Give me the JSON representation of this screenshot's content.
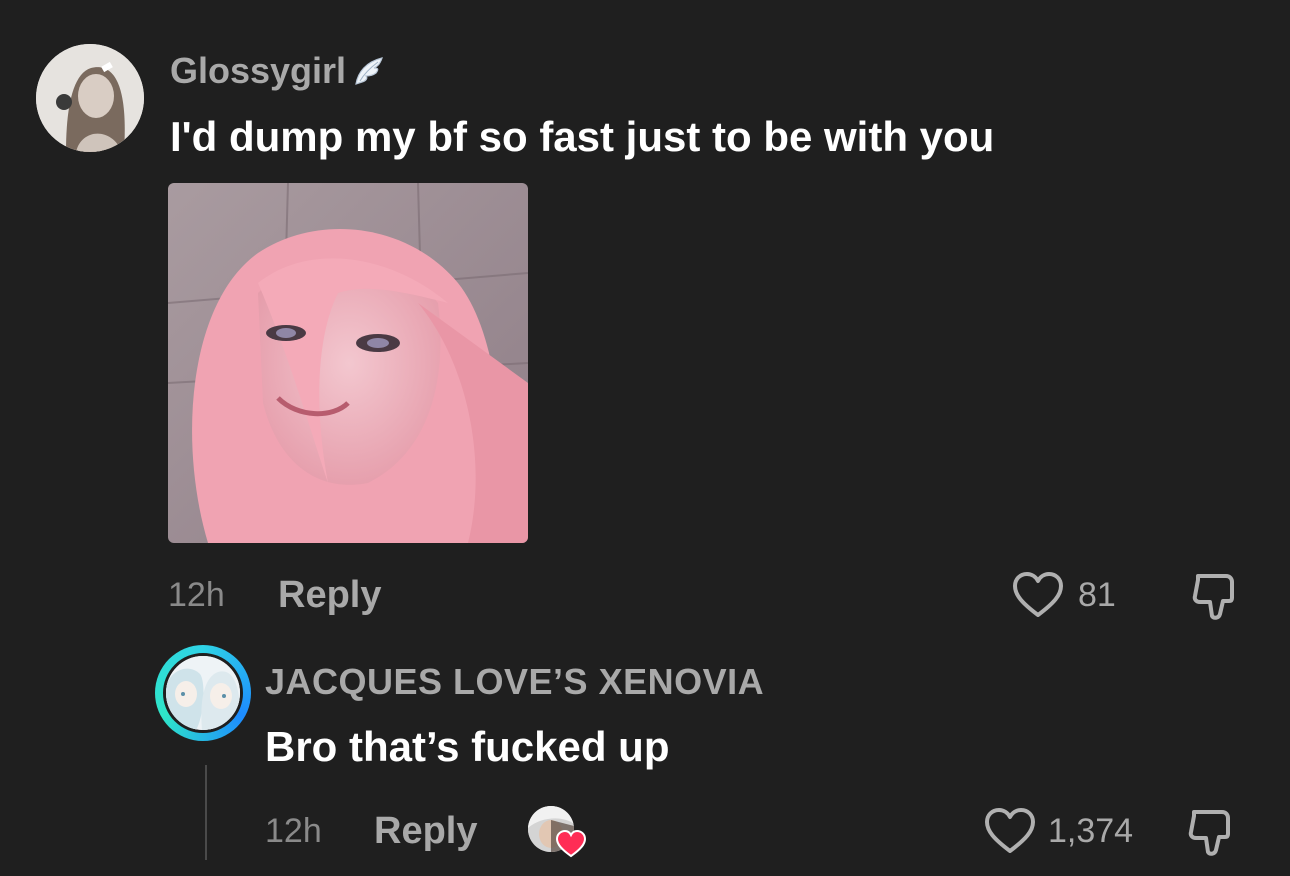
{
  "comments": [
    {
      "username": "Glossygirl",
      "username_badge_icon": "angel-wing-icon",
      "text": "I'd dump my bf so fast just to be with you",
      "attachment": "pink-hair-face-image",
      "time": "12h",
      "reply_label": "Reply",
      "likes": "81"
    }
  ],
  "replies": [
    {
      "username": "JACQUES LOVE’S XENOVIA",
      "text": "Bro that’s fucked up",
      "time": "12h",
      "reply_label": "Reply",
      "creator_liked_icon": "creator-heart-badge-icon",
      "likes": "1,374"
    }
  ],
  "colors": {
    "background": "#1f1f1f",
    "muted_text": "#a9a9a9",
    "primary_text": "#ffffff",
    "story_ring": "#2fd3e6",
    "heart_badge": "#ff2d55"
  }
}
